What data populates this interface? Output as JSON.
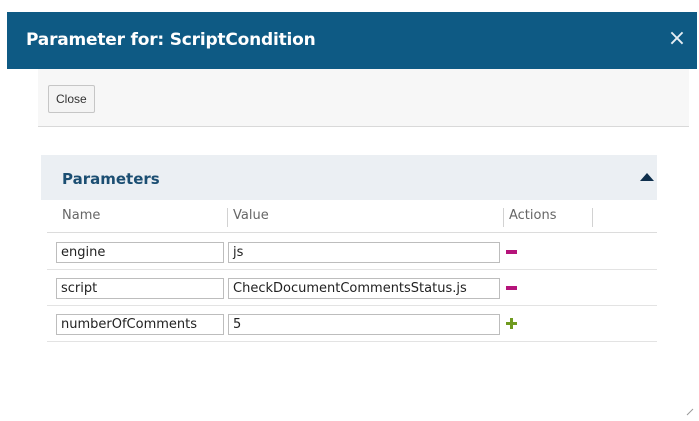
{
  "dialog": {
    "title": "Parameter for: ScriptCondition",
    "close_glyph": "×"
  },
  "toolbar": {
    "close_label": "Close"
  },
  "section": {
    "title": "Parameters",
    "collapse_icon": "triangle-up-icon"
  },
  "table": {
    "headers": {
      "name": "Name",
      "value": "Value",
      "actions": "Actions"
    },
    "rows": [
      {
        "name": "engine",
        "value": "js",
        "action": "remove"
      },
      {
        "name": "script",
        "value": "CheckDocumentCommentsStatus.js",
        "action": "remove"
      },
      {
        "name": "numberOfComments",
        "value": "5",
        "action": "add"
      }
    ]
  },
  "colors": {
    "titlebar": "#0e5a84",
    "section_title": "#1b4e72",
    "remove_icon": "#b5137a",
    "add_icon": "#6f9a1f"
  }
}
